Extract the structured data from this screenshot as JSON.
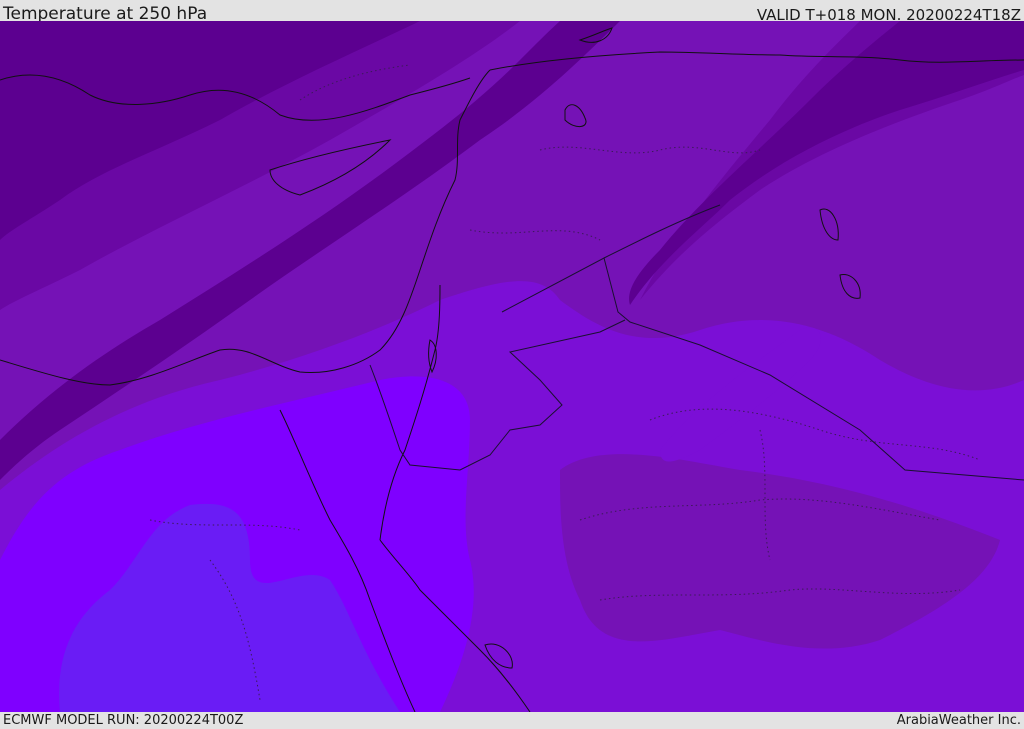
{
  "header": {
    "title": "Temperature at 250 hPa",
    "valid": "VALID T+018 MON. 20200224T18Z"
  },
  "footer": {
    "model_run": "ECMWF MODEL RUN: 20200224T00Z",
    "credit": "ArabiaWeather Inc."
  },
  "colors": {
    "band_coldest": "#5c0090",
    "band_cold": "#6a08a4",
    "band_mid": "#7512b6",
    "band_mid_warm": "#7b0fd6",
    "band_warm": "#7f00ff",
    "band_warmest": "#6a1cf5",
    "coastline": "#111111",
    "admin_border": "#3c1a58"
  }
}
